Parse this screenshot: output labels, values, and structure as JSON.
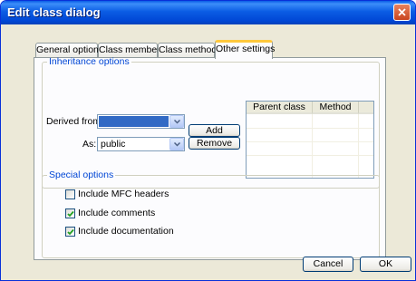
{
  "window": {
    "title": "Edit class dialog"
  },
  "tabs": [
    {
      "label": "General options",
      "active": false
    },
    {
      "label": "Class members",
      "active": false
    },
    {
      "label": "Class methods",
      "active": false
    },
    {
      "label": "Other settings",
      "active": true
    }
  ],
  "inheritance": {
    "legend": "Inheritance options",
    "derived_label": "Derived from:",
    "derived_value": "",
    "as_label": "As:",
    "as_value": "public",
    "add_label": "Add",
    "remove_label": "Remove",
    "columns": [
      "Parent class",
      "Method"
    ]
  },
  "special": {
    "legend": "Special options",
    "options": [
      {
        "label": "Include MFC headers",
        "checked": false
      },
      {
        "label": "Include comments",
        "checked": true
      },
      {
        "label": "Include documentation",
        "checked": true
      }
    ]
  },
  "footer": {
    "cancel_label": "Cancel",
    "ok_label": "OK"
  },
  "colors": {
    "accent": "#0046d5",
    "selection": "#316ac5",
    "tab_highlight": "#ffc83c"
  },
  "icons": {
    "close": "close-x-icon",
    "dropdown": "chevron-down-icon",
    "check": "checkmark-icon"
  }
}
